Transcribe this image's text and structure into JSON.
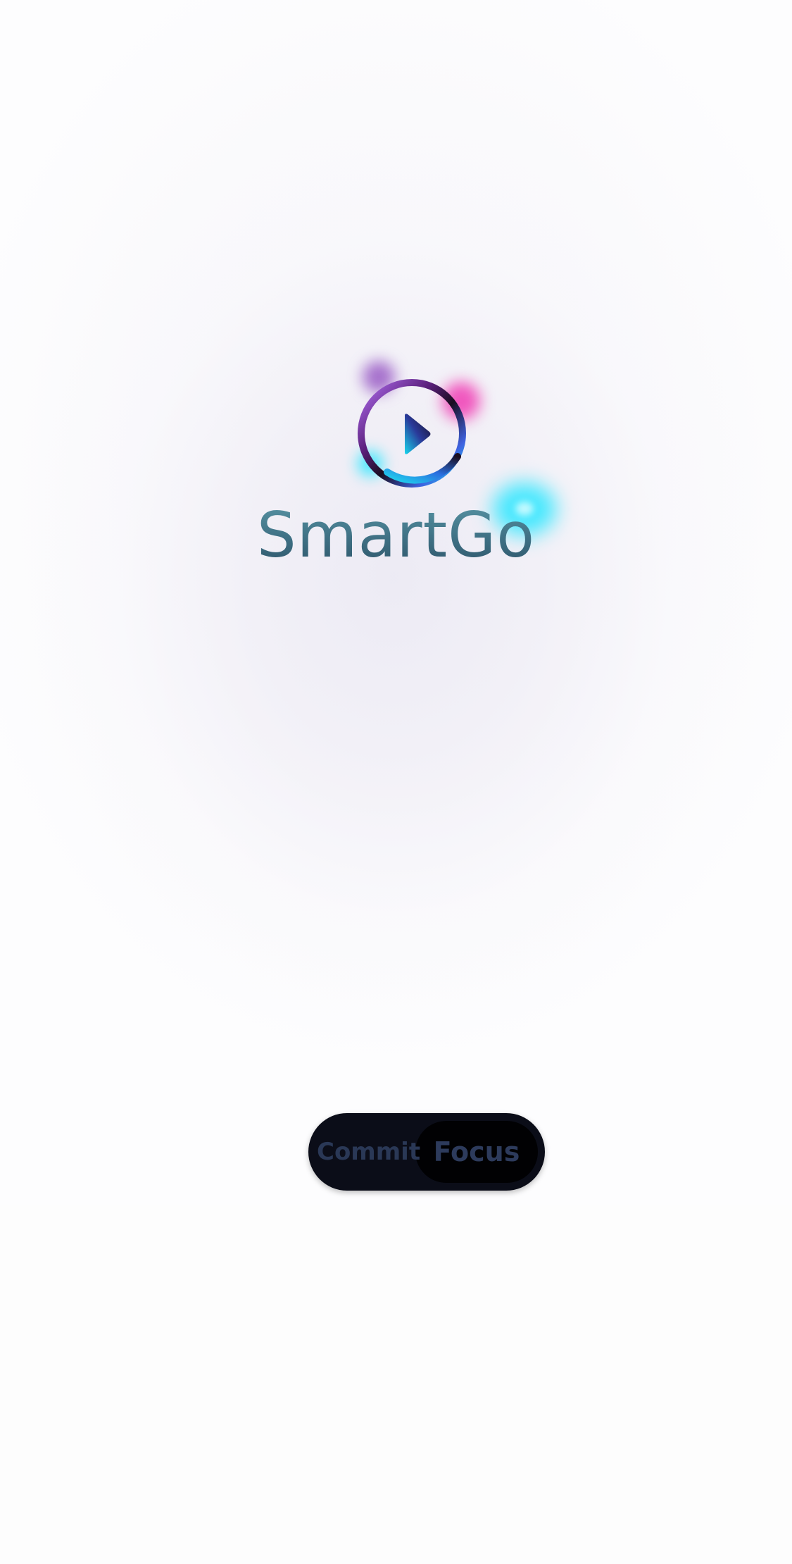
{
  "app": {
    "name": "SmartGo",
    "logo_icon": "play-circle-icon"
  },
  "mode_toggle": {
    "options": [
      "Commit",
      "Focus"
    ],
    "selected": "Focus"
  },
  "colors": {
    "background": "#fdfdfe",
    "title_gradient": [
      "#5d9cab",
      "#294e63"
    ],
    "toggle_bg": "#0b0d18",
    "toggle_knob": "#010103",
    "toggle_text": "#2c3a58",
    "accent_purple": "#a95ee8",
    "accent_pink": "#f03cb4",
    "accent_cyan": "#28e6ff"
  }
}
